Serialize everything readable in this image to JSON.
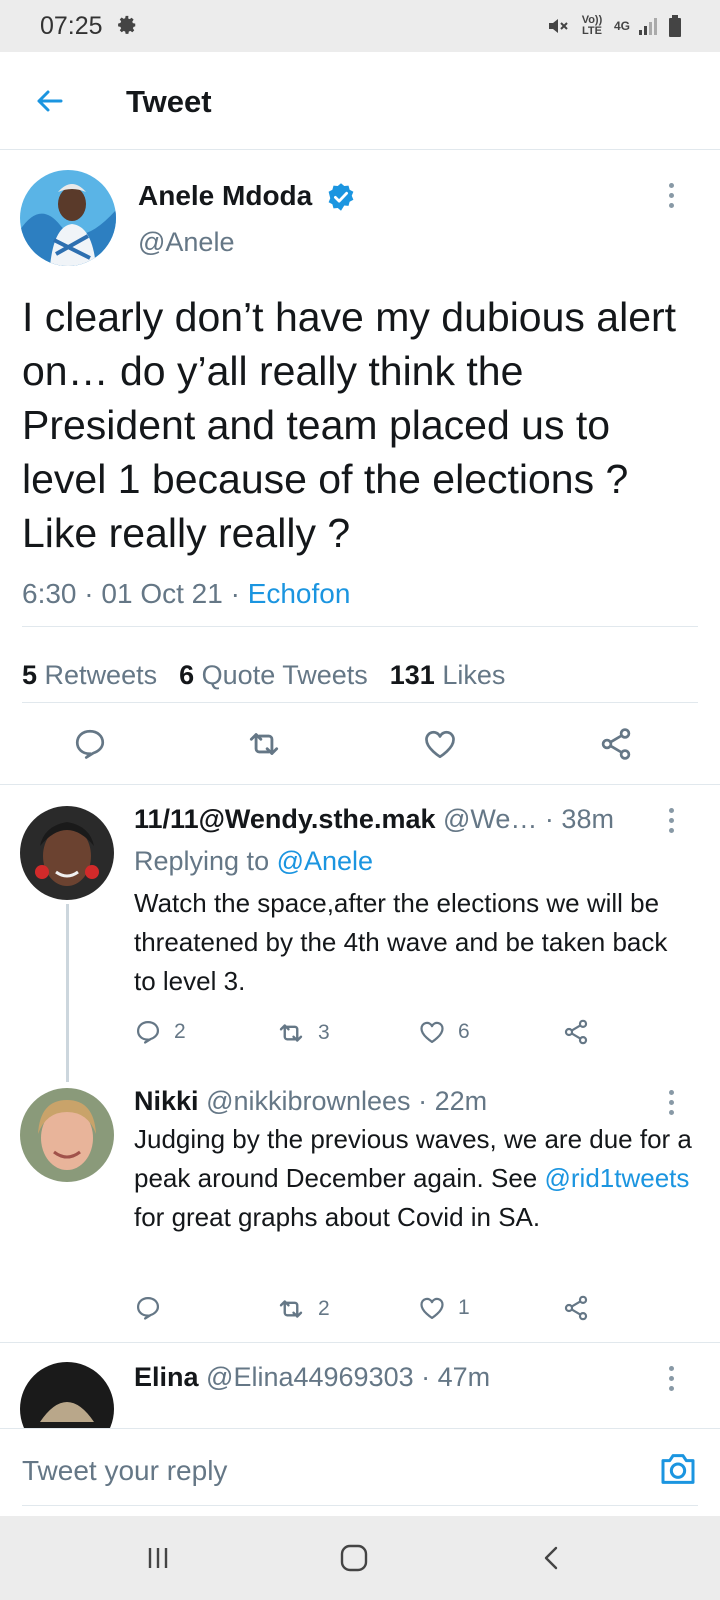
{
  "status_bar": {
    "time": "07:25",
    "icons": [
      "gear-icon",
      "mute-icon",
      "volte-icon",
      "4g-icon",
      "signal-icon",
      "battery-icon"
    ],
    "volte": "Vo)) LTE",
    "network": "4G"
  },
  "header": {
    "title": "Tweet"
  },
  "main_tweet": {
    "name": "Anele Mdoda",
    "handle": "@Anele",
    "text": "I clearly don’t have my dubious alert on… do y’all really think the President and team placed us to level 1 because of the elections ? Like really really ?",
    "time": "6:30",
    "date": "01 Oct 21",
    "source": "Echofon",
    "retweets_count": "5",
    "retweets_label": "Retweets",
    "quotes_count": "6",
    "quotes_label": "Quote Tweets",
    "likes_count": "131",
    "likes_label": "Likes"
  },
  "replies": [
    {
      "name": "11/11@Wendy.sthe.mak",
      "handle": "@We…",
      "time": "38m",
      "replying_prefix": "Replying to",
      "replying_to": "@Anele",
      "text": "Watch the space,after the elections we will be threatened by the 4th wave and be taken back to level 3.",
      "replies": "2",
      "retweets": "3",
      "likes": "6"
    },
    {
      "name": "Nikki",
      "handle": "@nikkibrownlees",
      "time": "22m",
      "text_before": "Judging by the previous waves, we are due for a peak around December again. See ",
      "mention": "@rid1tweets",
      "text_after": " for great graphs about Covid in SA.",
      "retweets": "2",
      "likes": "1"
    },
    {
      "name": "Elina",
      "handle": "@Elina44969303",
      "time": "47m"
    }
  ],
  "composer": {
    "placeholder": "Tweet your reply"
  },
  "colors": {
    "accent": "#1b95e0",
    "text": "#14171a",
    "muted": "#657786",
    "divider": "#e1e8ed"
  }
}
